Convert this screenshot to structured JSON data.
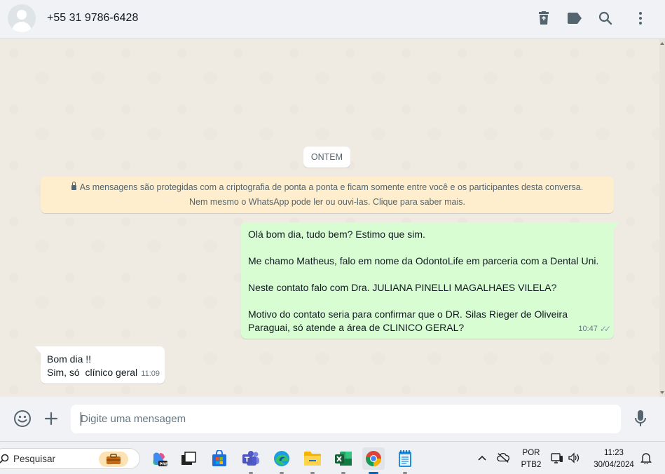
{
  "header": {
    "contact_name": "+55 31 9786-6428",
    "icons": [
      "delete-icon",
      "label-icon",
      "search-icon",
      "menu-icon"
    ]
  },
  "chat": {
    "date_chip": "ONTEM",
    "encryption_notice": "As mensagens são protegidas com a criptografia de ponta a ponta e ficam somente entre você e os participantes desta conversa. Nem mesmo o WhatsApp pode ler ou ouvi-las. Clique para saber mais.",
    "messages": [
      {
        "direction": "outgoing",
        "lines": [
          "Olá bom dia, tudo bem? Estimo que sim.",
          "Me chamo Matheus, falo em nome da OdontoLife em parceria com a Dental Uni.",
          "Neste contato falo com Dra. JULIANA PINELLI MAGALHAES VILELA?",
          "Motivo do contato seria para confirmar que o DR. Silas Rieger de Oliveira",
          "Paraguai, só atende a área de CLINICO GERAL?"
        ],
        "time": "10:47",
        "status": "delivered"
      },
      {
        "direction": "incoming",
        "lines": [
          "Bom dia !!",
          "Sim, só  clínico geral"
        ],
        "time": "11:09"
      }
    ]
  },
  "composer": {
    "placeholder": "Digite uma mensagem"
  },
  "taskbar": {
    "search_label": "Pesquisar",
    "apps": [
      "copilot",
      "task-view",
      "store",
      "teams",
      "edge",
      "file-explorer",
      "excel",
      "chrome",
      "notepad"
    ],
    "active_app": "chrome",
    "language_line1": "POR",
    "language_line2": "PTB2",
    "time": "11:23",
    "date": "30/04/2024"
  },
  "colors": {
    "outgoing_bubble": "#d9fdd3",
    "incoming_bubble": "#ffffff",
    "chat_background": "#efeae2",
    "notice_background": "#ffeecd"
  }
}
